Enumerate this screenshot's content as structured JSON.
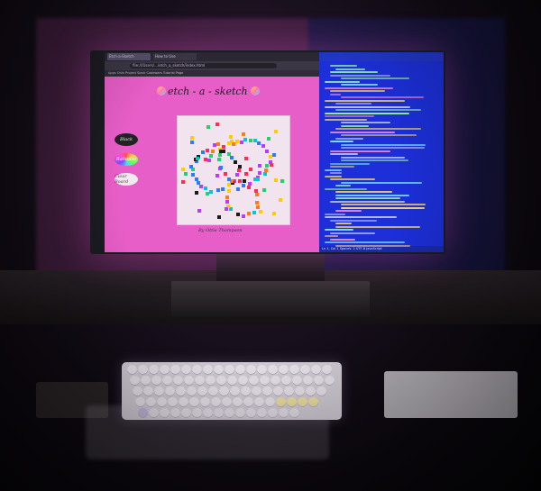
{
  "browser": {
    "tabs": [
      "Etch-a-Sketch",
      "How to Use"
    ],
    "url": "file:///Users/.../etch_a_sketch/index.html",
    "bookmarks": "Apps   Odin Project   Slack   Codewars   Tutorial Page"
  },
  "app": {
    "title": "etch - a - sketch",
    "buttons": {
      "black": "Black",
      "rainbow": "Rainbow",
      "clear": "Clear Board"
    },
    "footer": "By Ottie Thompson"
  },
  "editor": {
    "status": "Ln 1, Col 1   Spaces: 2   UTF-8   JavaScript"
  },
  "colors": {
    "page_bg": "#e85ec8",
    "editor_bg": "#1c2fd8",
    "grid_bg": "#f1e4ee"
  }
}
